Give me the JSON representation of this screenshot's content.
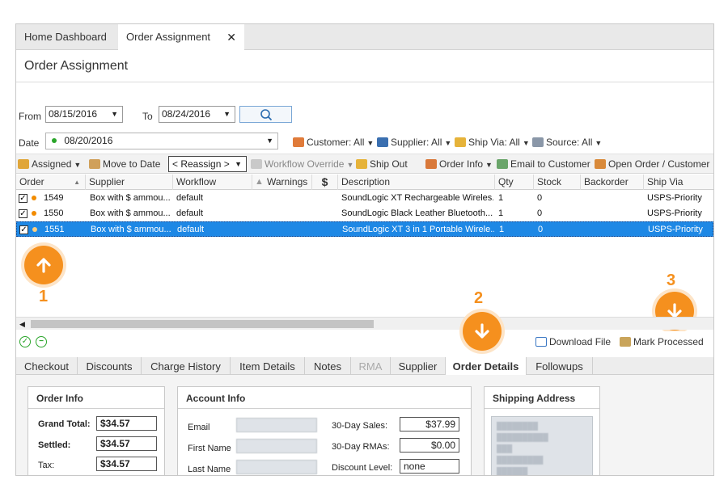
{
  "tabs": {
    "home": "Home Dashboard",
    "active": "Order Assignment",
    "close": "✕"
  },
  "page_title": "Order Assignment",
  "filters": {
    "from_label": "From",
    "from_value": "08/15/2016",
    "to_label": "To",
    "to_value": "08/24/2016",
    "date_label": "Date",
    "date_value": "08/20/2016",
    "customer": "Customer: All",
    "supplier": "Supplier: All",
    "ship_via": "Ship Via: All",
    "source": "Source: All"
  },
  "toolbar": {
    "assigned": "Assigned",
    "move_to_date": "Move to Date",
    "reassign": "< Reassign >",
    "workflow_override": "Workflow Override",
    "ship_out": "Ship Out",
    "order_info": "Order Info",
    "email_customer": "Email to Customer",
    "open_order": "Open Order / Customer"
  },
  "grid": {
    "columns": [
      "Order",
      "Supplier",
      "Workflow",
      "Warnings",
      "$",
      "Description",
      "Qty",
      "Stock",
      "Backorder",
      "Ship Via"
    ],
    "rows": [
      {
        "order": "1549",
        "supplier": "Box with $ ammou...",
        "workflow": "default",
        "description": "SoundLogic XT Rechargeable Wireles...",
        "qty": "1",
        "stock": "0",
        "ship_via": "USPS-Priority",
        "selected": false
      },
      {
        "order": "1550",
        "supplier": "Box with $ ammou...",
        "workflow": "default",
        "description": "SoundLogic Black Leather Bluetooth...",
        "qty": "1",
        "stock": "0",
        "ship_via": "USPS-Priority",
        "selected": false
      },
      {
        "order": "1551",
        "supplier": "Box with $ ammou...",
        "workflow": "default",
        "description": "SoundLogic XT 3 in 1 Portable Wirele...",
        "qty": "1",
        "stock": "0",
        "ship_via": "USPS-Priority",
        "selected": true
      }
    ]
  },
  "callouts": [
    "1",
    "2",
    "3"
  ],
  "status_actions": {
    "download": "Download File",
    "mark_processed": "Mark Processed"
  },
  "subtabs": [
    "Checkout",
    "Discounts",
    "Charge History",
    "Item Details",
    "Notes",
    "RMA",
    "Supplier",
    "Order Details",
    "Followups"
  ],
  "order_info": {
    "title": "Order Info",
    "grand_total_label": "Grand Total:",
    "grand_total": "$34.57",
    "settled_label": "Settled:",
    "settled": "$34.57",
    "tax_label": "Tax:",
    "tax": "$34.57"
  },
  "account_info": {
    "title": "Account Info",
    "email_label": "Email",
    "first_name_label": "First Name",
    "last_name_label": "Last Name",
    "sales_label": "30-Day Sales:",
    "sales": "$37.99",
    "rmas_label": "30-Day RMAs:",
    "rmas": "$0.00",
    "discount_label": "Discount Level:",
    "discount": "none"
  },
  "shipping": {
    "title": "Shipping Address"
  },
  "colors": {
    "accent_orange": "#f5901e",
    "selection_blue": "#1e88e5",
    "status_green": "#2aa52a"
  }
}
